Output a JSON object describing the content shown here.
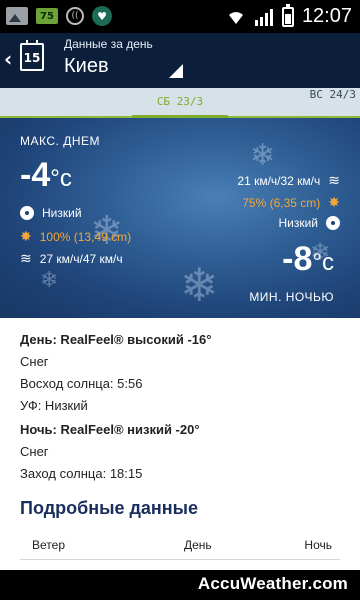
{
  "status_bar": {
    "badge": "75",
    "time": "12:07"
  },
  "header": {
    "subtitle": "Данные за день",
    "title": "Киев",
    "calendar_day": "15"
  },
  "tabs": {
    "active": "СБ 23/3",
    "next": "ВС 24/3"
  },
  "hero": {
    "day_label": "МАКС. ДНЕМ",
    "day_temp": "-4",
    "night_temp": "-8",
    "unit": "°c",
    "day_uv": "Низкий",
    "day_precip": "100% (13,49 cm)",
    "day_wind": "27 км/ч/47 км/ч",
    "night_wind": "21 км/ч/32 км/ч",
    "night_precip": "75% (6,35 cm)",
    "night_uv": "Низкий",
    "night_label": "МИН. НОЧЬЮ",
    "colors": {
      "accent_orange": "#f3a73a",
      "bg": "#2f5f95"
    }
  },
  "details": {
    "day_realfeel": "День: RealFeel® высокий -16°",
    "day_condition": "Снег",
    "sunrise": "Восход солнца: 5:56",
    "uv": "УФ: Низкий",
    "night_realfeel": "Ночь: RealFeel® низкий -20°",
    "night_condition": "Снег",
    "sunset": "Заход солнца: 18:15",
    "section_title": "Подробные данные",
    "table_headers": [
      "Ветер",
      "День",
      "Ночь"
    ]
  },
  "footer": {
    "brand": "AccuWeather.com"
  }
}
